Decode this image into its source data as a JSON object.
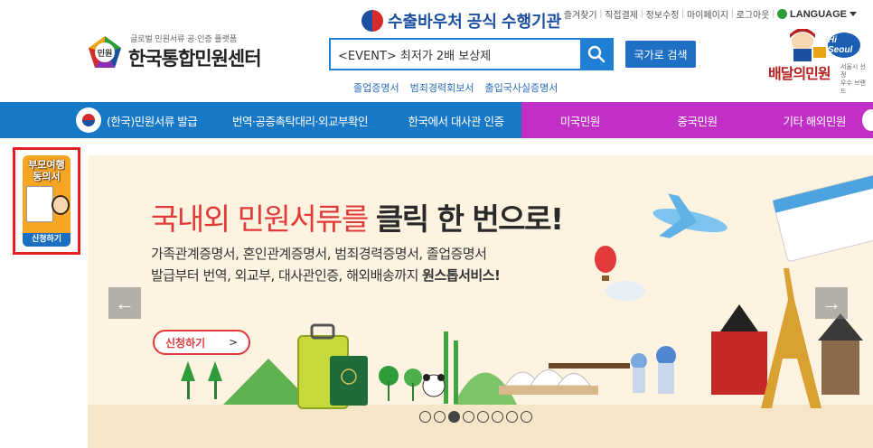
{
  "util_links": [
    "즐겨찾기",
    "직접결제",
    "정보수정",
    "마이페이지",
    "로그아웃"
  ],
  "language_label": "LANGUAGE",
  "logo": {
    "small": "글로벌 민원서류 공·인증 플랫폼",
    "badge": "민원",
    "name": "한국통합민원센터"
  },
  "voucher_title": "수출바우처 공식 수행기관",
  "search": {
    "value": "<EVENT> 최저가 2배 보상제",
    "button_label": "국가로 검색"
  },
  "quick_links": [
    "졸업증명서",
    "범죄경력회보서",
    "출입국사실증명서"
  ],
  "delivery_logo": {
    "text": "배달의민원",
    "badge": "Hi Seoul",
    "sub": [
      "서울시 선정",
      "우수 브랜드"
    ]
  },
  "nav": {
    "item1": "(한국)민원서류 발급",
    "item2": "번역·공증촉탁대리·외교부확인",
    "item3": "한국에서 대사관 인증",
    "item4": "미국민원",
    "item5": "중국민원",
    "item6": "기타 해외민원"
  },
  "side_banner": {
    "title_line1": "부모여행",
    "title_line2": "동의서",
    "apply": "신청하기"
  },
  "hero": {
    "title_red": "국내외 민원서류를",
    "title_dark": "클릭 한 번으로!",
    "line1": "가족관계증명서, 혼인관계증명서, 범죄경력증명서, 졸업증명서",
    "line2_plain": "발급부터 번역, 외교부, 대사관인증, 해외배송까지",
    "line2_bold": "원스톱서비스!",
    "apply_label": "신청하기",
    "apply_arrow": ">",
    "prev_arrow": "←",
    "next_arrow": "→",
    "slide_count": 8,
    "active_slide": 3
  },
  "colors": {
    "nav_blue": "#1878c8",
    "nav_magenta": "#c12fc6",
    "accent_red": "#e23a3a",
    "search_blue": "#1f7fd4"
  }
}
